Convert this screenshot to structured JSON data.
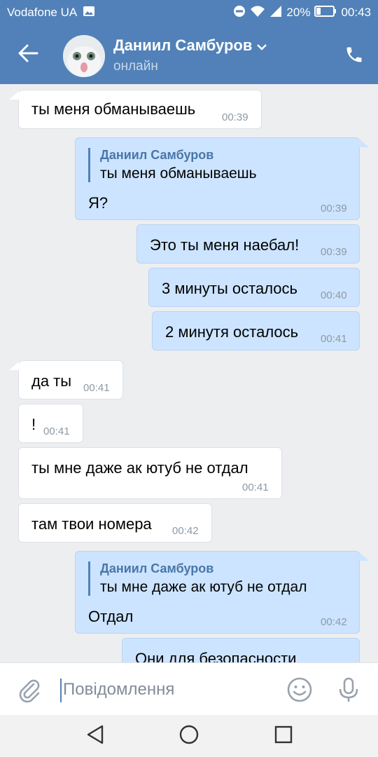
{
  "statusbar": {
    "carrier": "Vodafone UA",
    "battery": "20%",
    "time": "00:43"
  },
  "header": {
    "contact_name": "Даниил Самбуров",
    "contact_status": "онлайн"
  },
  "messages": [
    {
      "direction": "in",
      "text": "ты меня обманываешь",
      "time": "00:39"
    },
    {
      "direction": "out",
      "reply_to": {
        "name": "Даниил Самбуров",
        "text": "ты меня обманываешь"
      },
      "text": "Я?",
      "time": "00:39"
    },
    {
      "direction": "out",
      "text": "Это ты меня наебал!",
      "time": "00:39"
    },
    {
      "direction": "out",
      "text": "3 минуты осталось",
      "time": "00:40"
    },
    {
      "direction": "out",
      "text": "2 минутя осталось",
      "time": "00:41"
    },
    {
      "direction": "in",
      "text": "да ты",
      "time": "00:41"
    },
    {
      "direction": "in",
      "text": "!",
      "time": "00:41"
    },
    {
      "direction": "in",
      "text": "ты мне даже ак ютуб не отдал",
      "time": "00:41"
    },
    {
      "direction": "in",
      "text": "там твои номера",
      "time": "00:42"
    },
    {
      "direction": "out",
      "reply_to": {
        "name": "Даниил Самбуров",
        "text": "ты мне даже ак ютуб не отдал"
      },
      "text": "Отдал",
      "time": "00:42"
    },
    {
      "direction": "out",
      "text": "Они для безопасности",
      "time": ""
    }
  ],
  "composer": {
    "placeholder": "Повідомлення"
  },
  "icons": {
    "back": "arrow-left-icon",
    "dropdown": "chevron-down-icon",
    "call": "phone-icon",
    "attach": "paperclip-icon",
    "emoji": "smile-icon",
    "mic": "microphone-icon",
    "nav_back": "triangle-back-icon",
    "nav_home": "circle-home-icon",
    "nav_recent": "square-recent-icon"
  },
  "colors": {
    "header": "#5181b8",
    "outgoing_bubble": "#cce4ff",
    "incoming_bubble": "#ffffff",
    "background": "#edeef0",
    "reply_name": "#4a76a8"
  }
}
